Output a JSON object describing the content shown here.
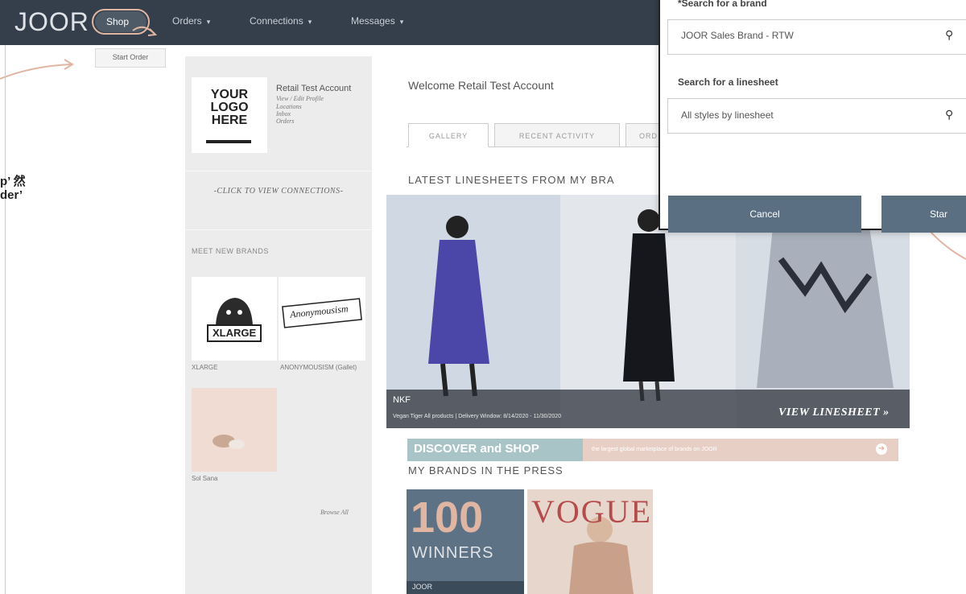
{
  "nav": {
    "logo": "JOOR",
    "shop": "Shop",
    "orders": "Orders",
    "connections": "Connections",
    "messages": "Messages",
    "caret": "▾",
    "dropdown_item": "Start Order"
  },
  "annotation": {
    "line1": "p’ 然",
    "line2": "der’"
  },
  "account": {
    "logo_line1": "YOUR",
    "logo_line2": "LOGO",
    "logo_line3": "HERE",
    "name": "Retail Test Account",
    "link_profile": "View / Edit Profile",
    "link_locations": "Locations",
    "link_inbox": "Inbox",
    "link_orders": "Orders"
  },
  "sidebar": {
    "view_connections": "-CLICK TO VIEW CONNECTIONS-",
    "meet_brands": "MEET NEW BRANDS",
    "brands": [
      {
        "name": "XLARGE",
        "logo": "XLARGE"
      },
      {
        "name": "ANONYMOUSISM (Gallet)",
        "logo": "Anonymousism"
      },
      {
        "name": "Sol Sana"
      }
    ],
    "browse_all": "Browse All"
  },
  "main": {
    "welcome": "Welcome Retail Test Account",
    "tabs": [
      "GALLERY",
      "RECENT ACTIVITY",
      "ORD"
    ],
    "latest_title": "LATEST LINESHEETS FROM MY BRA",
    "banner_brand": "NKF",
    "banner_sub": "Vegan Tiger All products | Delivery Window: 8/14/2020 - 11/30/2020",
    "banner_link": "VIEW LINESHEET »",
    "discover_text": "DISCOVER and SHOP",
    "discover_tagline": "the largest global marketplace of brands on JOOR",
    "discover_arrow": "➜",
    "press_title": "MY BRANDS IN THE PRESS",
    "press1_number": "100",
    "press1_sub": "WINNERS",
    "press1_tag": "JOOR",
    "press2_title": "VOGUE"
  },
  "modal": {
    "brand_label": "*Search for a brand",
    "brand_value": "JOOR Sales Brand - RTW",
    "linesheet_label": "Search for a linesheet",
    "linesheet_value": "All styles by linesheet",
    "search_icon": "⚲",
    "cancel": "Cancel",
    "start": "Star"
  },
  "colors": {
    "nav_bg": "#343f4b",
    "accent": "#e0b6a3",
    "button": "#5a6f81"
  }
}
